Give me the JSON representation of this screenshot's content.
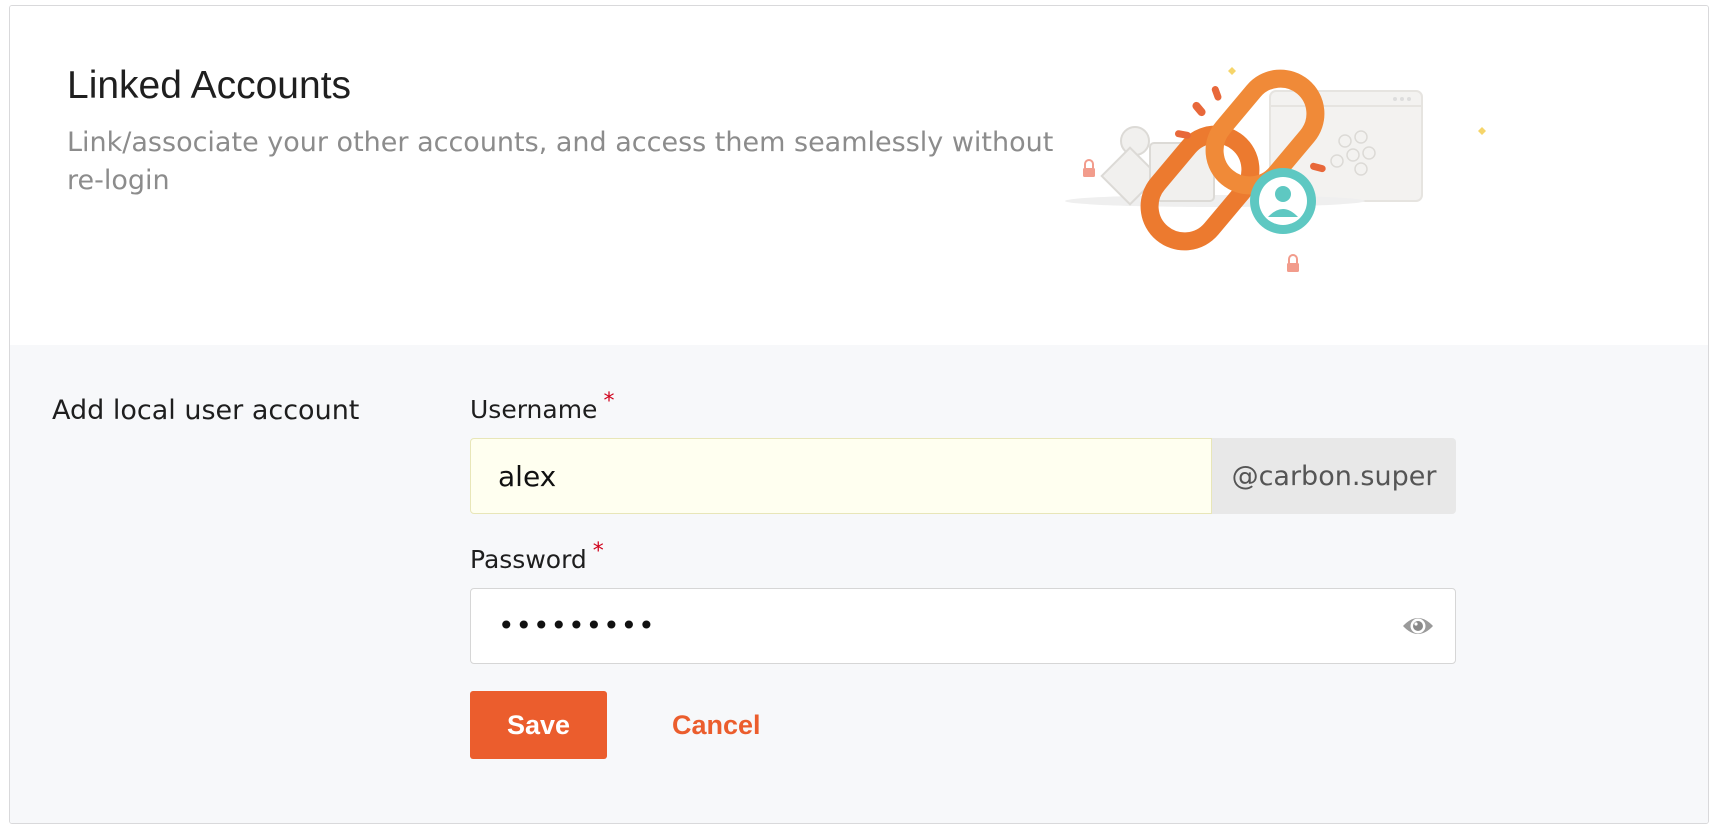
{
  "header": {
    "title": "Linked Accounts",
    "subtitle": "Link/associate your other accounts, and access them seamlessly without re-login",
    "illustration_icon": "linked-chain-illustration"
  },
  "form": {
    "section_label": "Add local user account",
    "username": {
      "label": "Username",
      "required_mark": "*",
      "value": "alex",
      "suffix": "@carbon.super"
    },
    "password": {
      "label": "Password",
      "required_mark": "*",
      "value": "•••••••••",
      "toggle_icon": "eye-icon"
    },
    "save_label": "Save",
    "cancel_label": "Cancel"
  },
  "colors": {
    "accent": "#eb5d2d",
    "required": "#d0021b",
    "form_background": "#f7f8fa",
    "autofill_background": "#fffff0"
  }
}
